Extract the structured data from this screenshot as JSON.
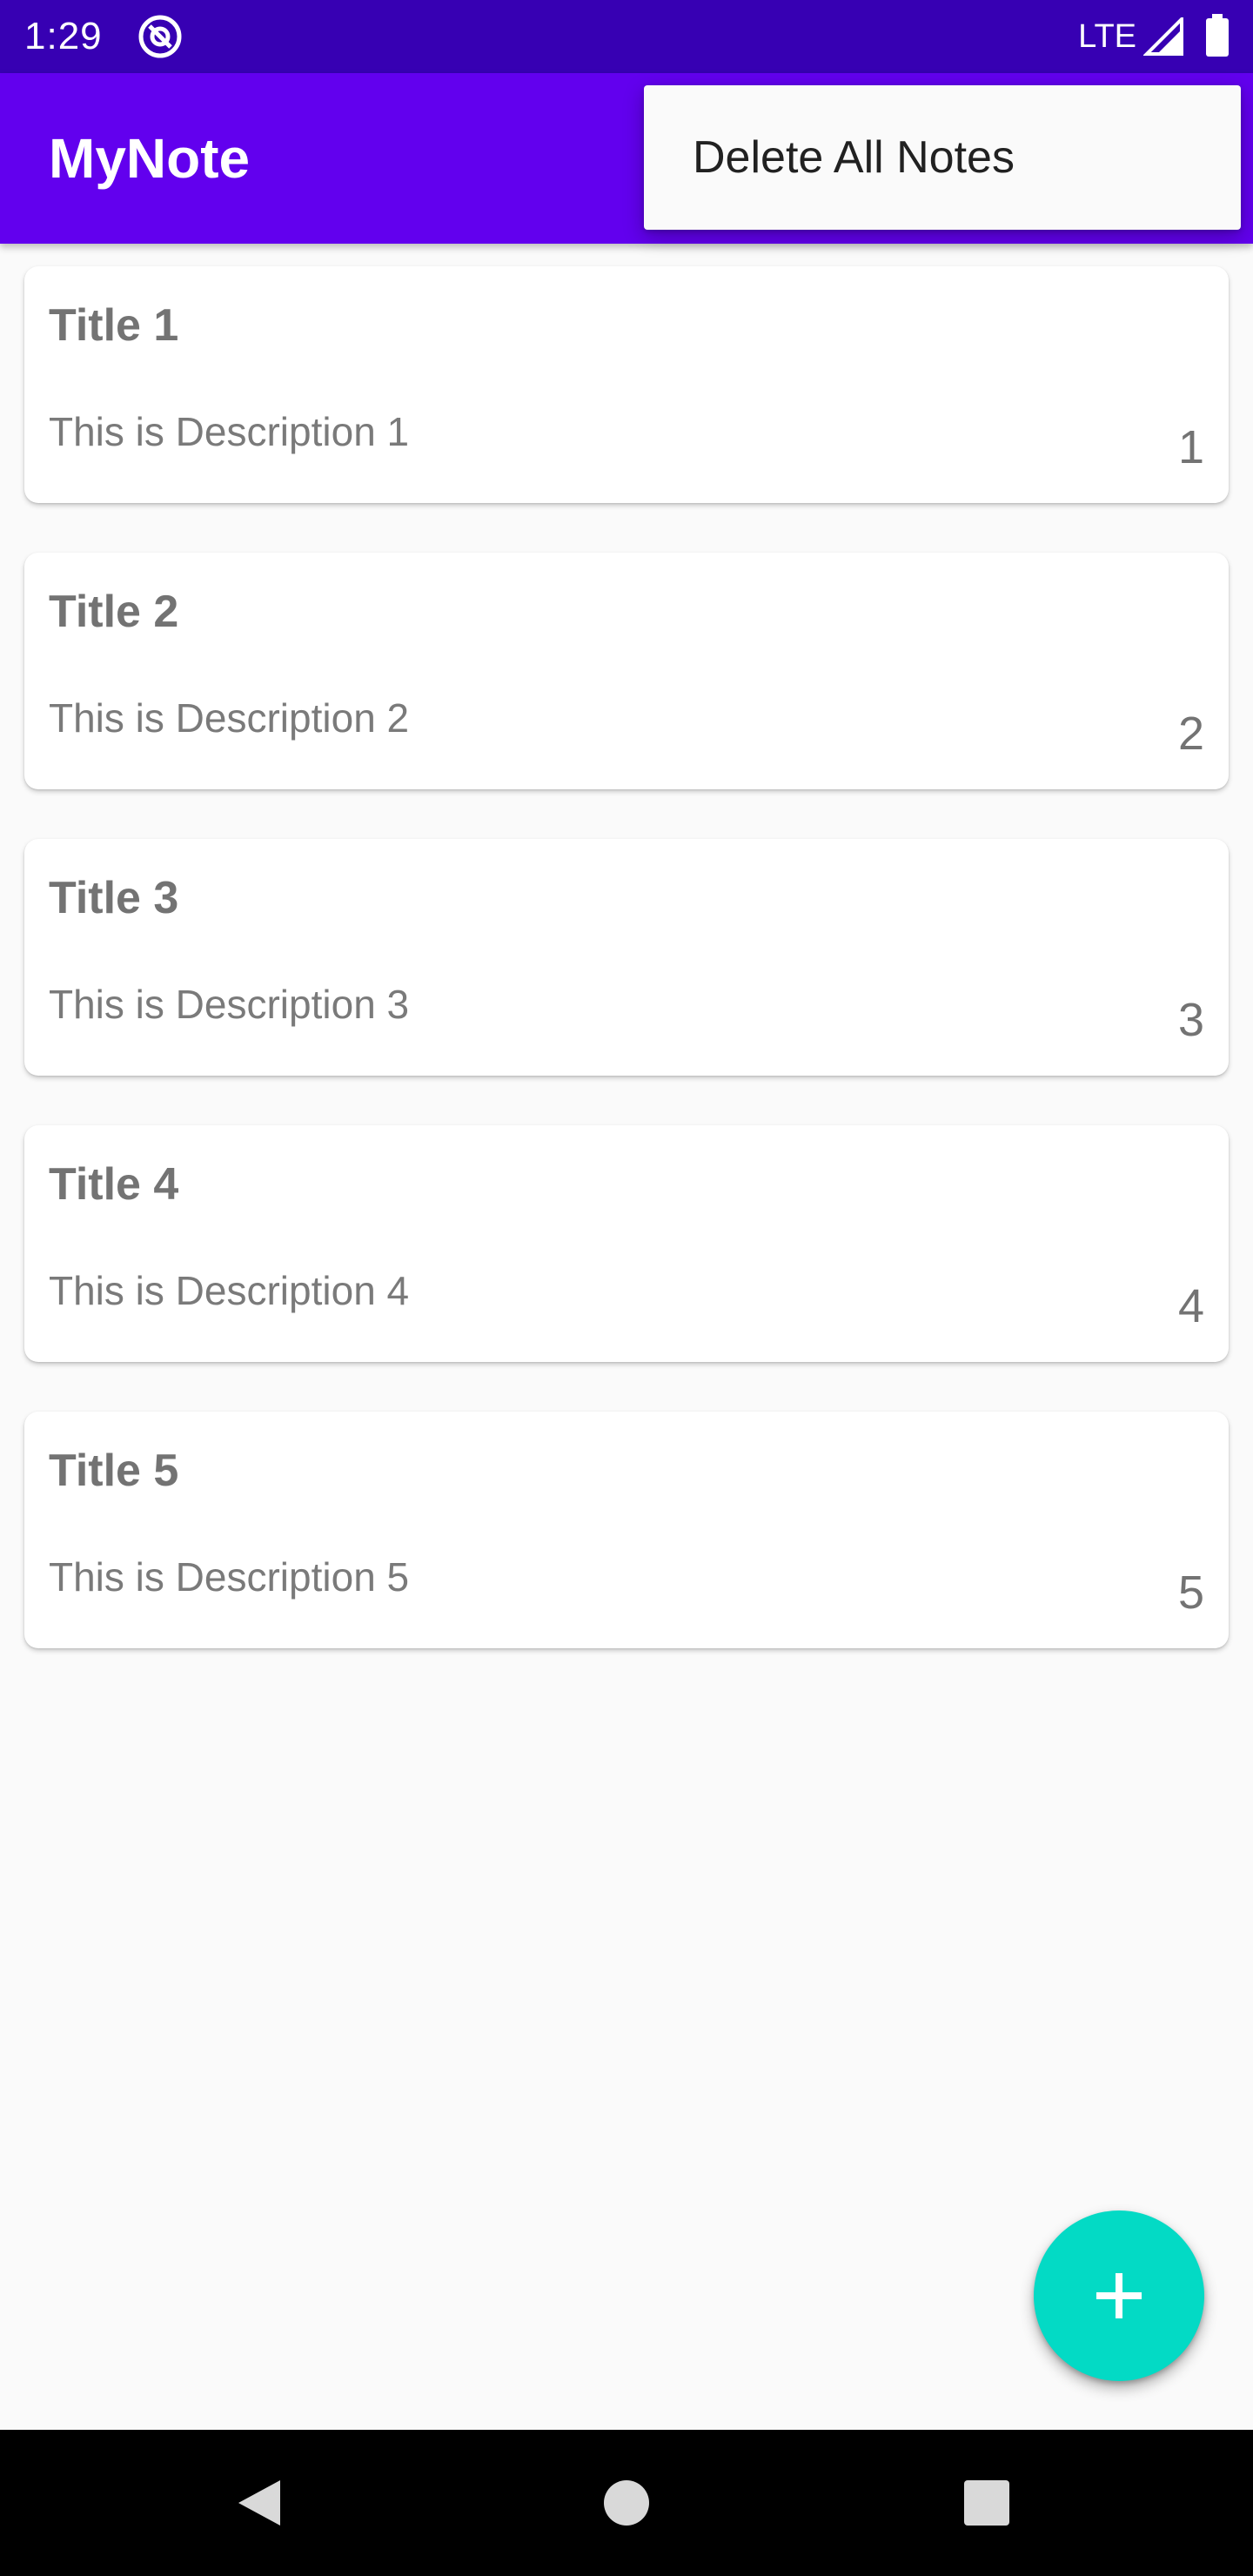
{
  "status_bar": {
    "time": "1:29",
    "network": "LTE",
    "app_icon": "at-sign-icon",
    "signal_icon": "signal-icon",
    "battery_icon": "battery-icon",
    "color": "#3700b3"
  },
  "app_bar": {
    "title": "MyNote",
    "color": "#6200ee"
  },
  "overflow_menu": {
    "items": [
      {
        "label": "Delete All Notes"
      }
    ]
  },
  "notes": [
    {
      "title": "Title 1",
      "description": "This is Description 1",
      "priority": "1"
    },
    {
      "title": "Title 2",
      "description": "This is Description 2",
      "priority": "2"
    },
    {
      "title": "Title 3",
      "description": "This is Description 3",
      "priority": "3"
    },
    {
      "title": "Title 4",
      "description": "This is Description 4",
      "priority": "4"
    },
    {
      "title": "Title 5",
      "description": "This is Description 5",
      "priority": "5"
    }
  ],
  "fab": {
    "icon": "plus-icon",
    "color": "#03dac5"
  },
  "nav_bar": {
    "back_icon": "back-triangle-icon",
    "home_icon": "home-circle-icon",
    "recents_icon": "recents-square-icon"
  }
}
